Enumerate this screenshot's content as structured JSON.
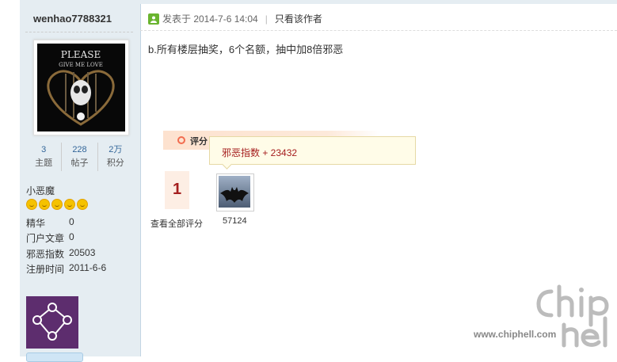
{
  "sidebar": {
    "username": "wenhao7788321",
    "avatar_text": "PLEASE GIVE ME LOVE",
    "stats": [
      {
        "value": "3",
        "label": "主题"
      },
      {
        "value": "228",
        "label": "帖子"
      },
      {
        "value": "2万",
        "label": "积分"
      }
    ],
    "user_title": "小恶魔",
    "star_count": 5,
    "info": [
      {
        "label": "精华",
        "value": "0"
      },
      {
        "label": "门户文章",
        "value": "0"
      },
      {
        "label": "邪恶指数",
        "value": "20503"
      },
      {
        "label": "注册时间",
        "value": "2011-6-6"
      }
    ]
  },
  "post": {
    "posted_at": "发表于 2014-7-6 14:04",
    "only_author": "只看该作者",
    "body": "b.所有楼层抽奖，6个名额，抽中加8倍邪恶"
  },
  "rating": {
    "label": "评分",
    "count": "1",
    "see_all": "查看全部评分",
    "rater_name": "57124",
    "tooltip": "邪恶指数 + 23432"
  },
  "watermark": {
    "url": "www.chiphell.com"
  },
  "colors": {
    "sidebar_bg": "#e5edf2",
    "accent_red": "#a41e1e",
    "link_blue": "#336699",
    "rate_orange": "#f26c4f"
  }
}
